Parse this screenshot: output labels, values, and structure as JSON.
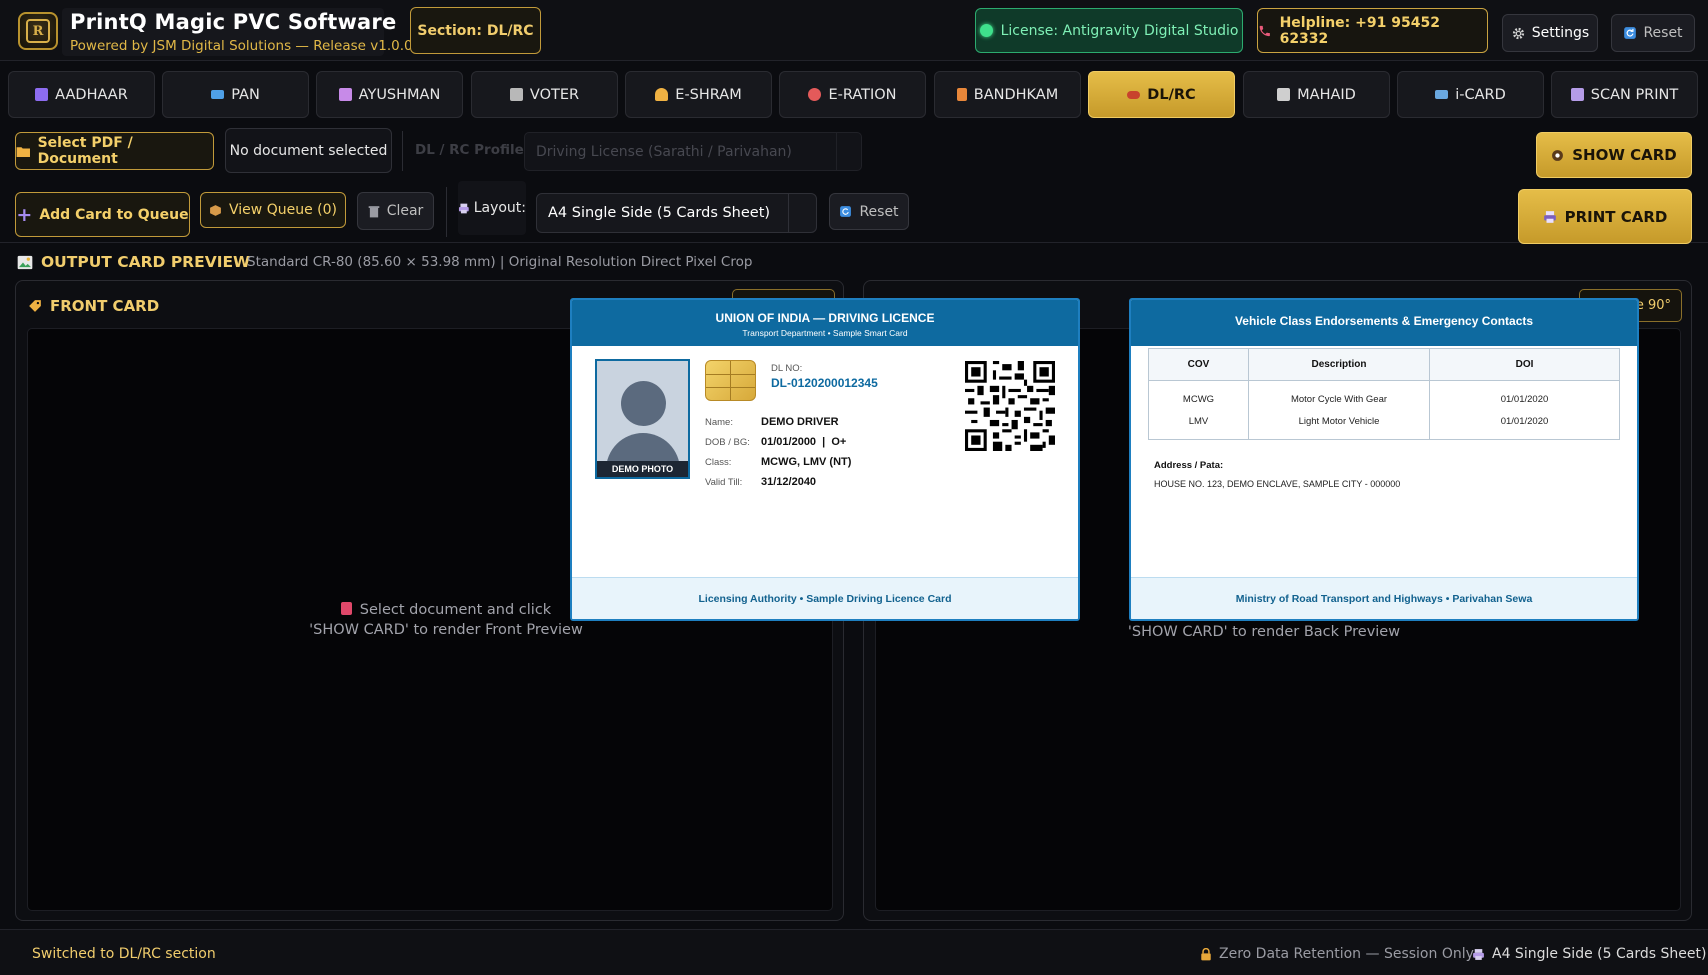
{
  "header": {
    "title": "PrintQ Magic PVC Software",
    "subtitle": "Powered by JSM Digital Solutions — Release v1.0.0",
    "section": "Section: DL/RC",
    "license": "License: Antigravity Digital Studio",
    "helpline": "Helpline: +91 95452 62332",
    "settings": "Settings",
    "reset": "Reset",
    "accent": "#e5bd48"
  },
  "tabs": [
    {
      "label": "AADHAAR",
      "icon": "id-icon",
      "color": "#8d6cf0"
    },
    {
      "label": "PAN",
      "icon": "card-icon",
      "color": "#4fa0e8"
    },
    {
      "label": "AYUSHMAN",
      "icon": "medical-icon",
      "color": "#c78ae8"
    },
    {
      "label": "VOTER",
      "icon": "ballot-icon",
      "color": "#b8b8b8"
    },
    {
      "label": "E-SHRAM",
      "icon": "worker-icon",
      "color": "#f0b243"
    },
    {
      "label": "E-RATION",
      "icon": "ration-icon",
      "color": "#e45a5a"
    },
    {
      "label": "BANDHKAM",
      "icon": "building-icon",
      "color": "#e8873a"
    },
    {
      "label": "DL/RC",
      "icon": "car-icon",
      "color": "#c8422d",
      "active": true
    },
    {
      "label": "MAHAID",
      "icon": "bank-icon",
      "color": "#cfcfcf"
    },
    {
      "label": "i-CARD",
      "icon": "badge-icon",
      "color": "#6aa8e0"
    },
    {
      "label": "SCAN PRINT",
      "icon": "printer-icon",
      "color": "#b59ce8"
    }
  ],
  "controls": {
    "select_pdf": "Select PDF / Document",
    "doc_status": "No document selected",
    "profile_label": "DL / RC Profile:",
    "profile_value": "Driving License (Sarathi / Parivahan)",
    "show_card": "SHOW CARD",
    "add_queue": "Add Card to Queue",
    "view_queue": "View Queue (0)",
    "clear": "Clear",
    "layout_label": "Layout:",
    "layout_value": "A4 Single Side (5 Cards Sheet)",
    "reset": "Reset",
    "print_card": "PRINT CARD"
  },
  "preview": {
    "title": "OUTPUT CARD PREVIEW",
    "subtitle": "Standard CR-80 (85.60 × 53.98 mm) | Original Resolution Direct Pixel Crop",
    "front_title": "FRONT CARD",
    "front_placeholder_1": "Select document and click",
    "front_placeholder_2": "'SHOW CARD' to render Front Preview",
    "back_placeholder": "'SHOW CARD' to render Back Preview",
    "rotate_label": "e 90°"
  },
  "front_card": {
    "title": "UNION OF INDIA — DRIVING LICENCE",
    "subtitle": "Transport Department • Sample Smart Card",
    "photo_caption": "DEMO PHOTO",
    "dl_no_label": "DL NO:",
    "dl_no": "DL-0120200012345",
    "fields": [
      {
        "key": "Name:",
        "value": "DEMO DRIVER"
      },
      {
        "key": "DOB / BG:",
        "value": "01/01/2000  |  O+"
      },
      {
        "key": "Class:",
        "value": "MCWG, LMV (NT)"
      },
      {
        "key": "Valid Till:",
        "value": "31/12/2040"
      }
    ],
    "footer": "Licensing Authority • Sample Driving Licence Card"
  },
  "back_card": {
    "title": "Vehicle Class Endorsements & Emergency Contacts",
    "columns": [
      "COV",
      "Description",
      "DOI"
    ],
    "rows": [
      [
        "MCWG",
        "Motor Cycle With Gear",
        "01/01/2020"
      ],
      [
        "LMV",
        "Light Motor Vehicle",
        "01/01/2020"
      ]
    ],
    "address_label": "Address / Pata:",
    "address": "HOUSE NO. 123, DEMO ENCLAVE, SAMPLE CITY - 000000",
    "footer": "Ministry of Road Transport and Highways • Parivahan Sewa"
  },
  "status": {
    "message": "Switched to DL/RC section",
    "retention": "Zero Data Retention — Session Only",
    "layout": "A4 Single Side (5 Cards Sheet)"
  }
}
